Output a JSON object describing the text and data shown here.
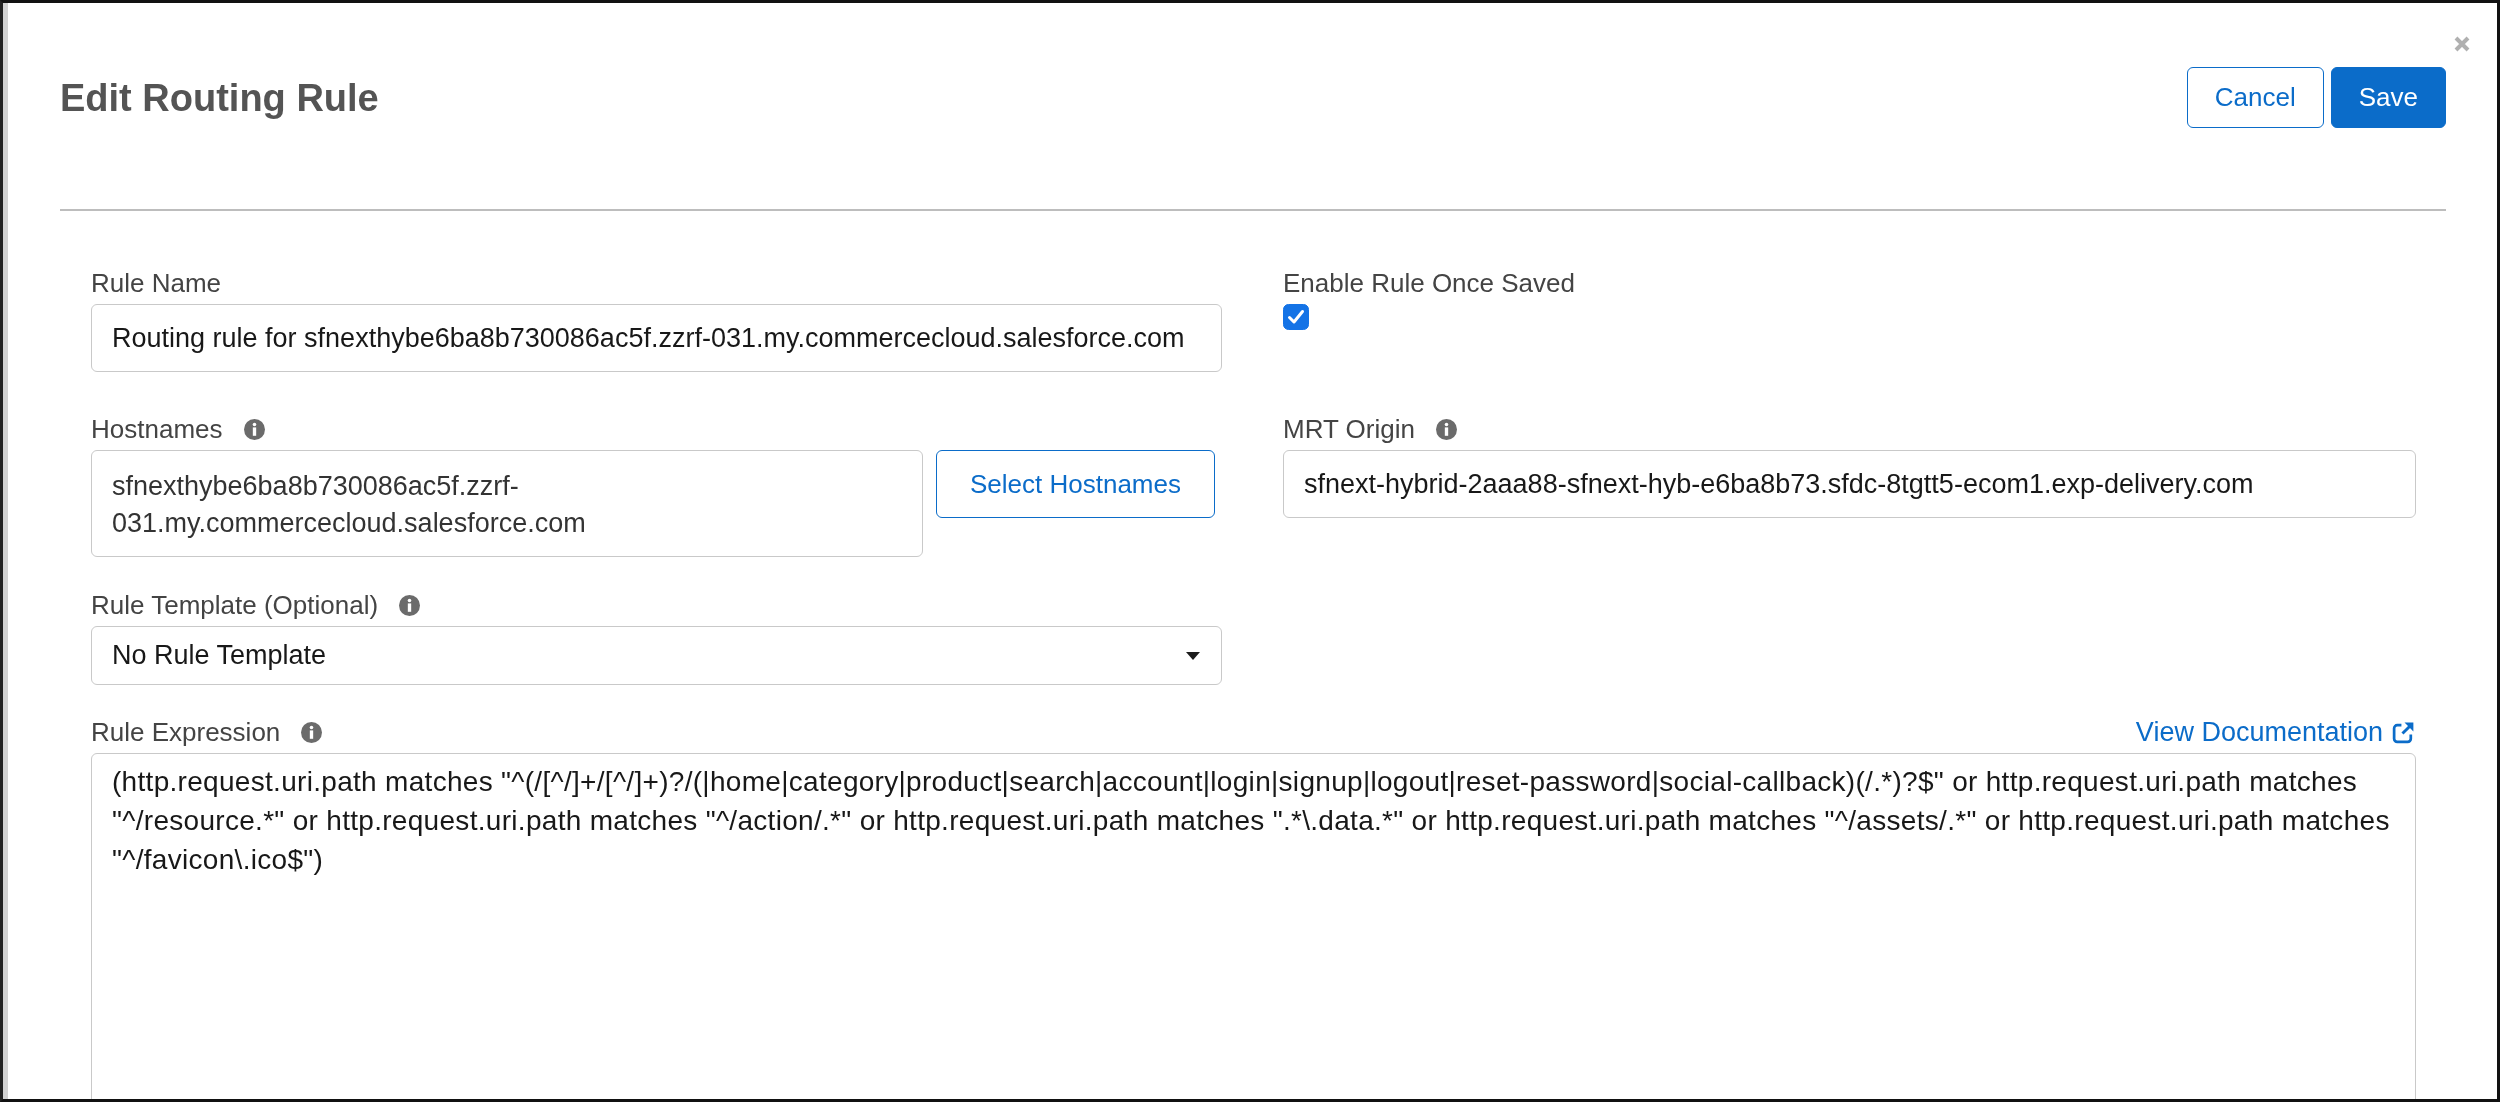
{
  "dialog": {
    "title": "Edit Routing Rule",
    "buttons": [
      {
        "label": "Cancel",
        "kind": "secondary"
      },
      {
        "label": "Save",
        "kind": "primary"
      }
    ]
  },
  "form": {
    "rule_name": {
      "label": "Rule Name",
      "value": "Routing rule for sfnexthybe6ba8b730086ac5f.zzrf-031.my.commercecloud.salesforce.com"
    },
    "enable_rule": {
      "label": "Enable Rule Once Saved",
      "checked": true
    },
    "hostnames": {
      "label": "Hostnames",
      "value": "sfnexthybe6ba8b730086ac5f.zzrf-031.my.commercecloud.salesforce.com",
      "button": "Select Hostnames"
    },
    "mrt_origin": {
      "label": "MRT Origin",
      "value": "sfnext-hybrid-2aaa88-sfnext-hyb-e6ba8b73.sfdc-8tgtt5-ecom1.exp-delivery.com"
    },
    "rule_template": {
      "label": "Rule Template (Optional)",
      "value": "No Rule Template"
    },
    "rule_expression": {
      "label": "Rule Expression",
      "link": "View Documentation",
      "value": "(http.request.uri.path matches \"^(/[^/]+/[^/]+)?/(|home|category|product|search|account|login|signup|logout|reset-password|social-callback)(/.*)?$\" or http.request.uri.path matches \"^/resource.*\" or http.request.uri.path matches \"^/action/.*\" or http.request.uri.path matches \".*\\.data.*\" or http.request.uri.path matches \"^/assets/.*\" or http.request.uri.path matches \"^/favicon\\.ico$\")"
    }
  }
}
